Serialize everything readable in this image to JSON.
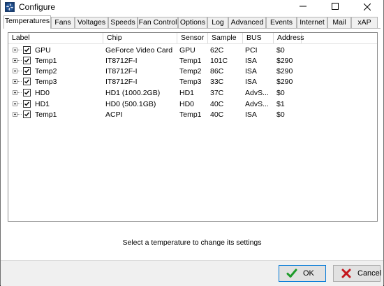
{
  "window": {
    "title": "Configure"
  },
  "tabs": [
    {
      "label": "Temperatures",
      "active": true
    },
    {
      "label": "Fans"
    },
    {
      "label": "Voltages"
    },
    {
      "label": "Speeds"
    },
    {
      "label": "Fan Control"
    },
    {
      "label": "Options"
    },
    {
      "label": "Log"
    },
    {
      "label": "Advanced"
    },
    {
      "label": "Events"
    },
    {
      "label": "Internet"
    },
    {
      "label": "Mail"
    },
    {
      "label": "xAP"
    }
  ],
  "table": {
    "columns": [
      "Label",
      "Chip",
      "Sensor",
      "Sample",
      "BUS",
      "Address"
    ],
    "rows": [
      {
        "label": "GPU",
        "chip": "GeForce Video Card",
        "sensor": "GPU",
        "sample": "62C",
        "bus": "PCI",
        "address": "$0",
        "checked": true
      },
      {
        "label": "Temp1",
        "chip": "IT8712F-I",
        "sensor": "Temp1",
        "sample": "101C",
        "bus": "ISA",
        "address": "$290",
        "checked": true
      },
      {
        "label": "Temp2",
        "chip": "IT8712F-I",
        "sensor": "Temp2",
        "sample": "86C",
        "bus": "ISA",
        "address": "$290",
        "checked": true
      },
      {
        "label": "Temp3",
        "chip": "IT8712F-I",
        "sensor": "Temp3",
        "sample": "33C",
        "bus": "ISA",
        "address": "$290",
        "checked": true
      },
      {
        "label": "HD0",
        "chip": "HD1 (1000.2GB)",
        "sensor": "HD1",
        "sample": "37C",
        "bus": "AdvS...",
        "address": "$0",
        "checked": true
      },
      {
        "label": "HD1",
        "chip": "HD0 (500.1GB)",
        "sensor": "HD0",
        "sample": "40C",
        "bus": "AdvS...",
        "address": "$1",
        "checked": true
      },
      {
        "label": "Temp1",
        "chip": "ACPI",
        "sensor": "Temp1",
        "sample": "40C",
        "bus": "ISA",
        "address": "$0",
        "checked": true
      }
    ]
  },
  "hint": "Select a temperature to change its settings",
  "buttons": {
    "ok": "OK",
    "cancel": "Cancel"
  },
  "icons": {
    "app": "fan-icon",
    "ok": "checkmark-icon",
    "cancel": "x-icon"
  },
  "colors": {
    "ok_check": "#1e9b2a",
    "cancel_x": "#c4161c",
    "focus_border": "#0078d7"
  }
}
